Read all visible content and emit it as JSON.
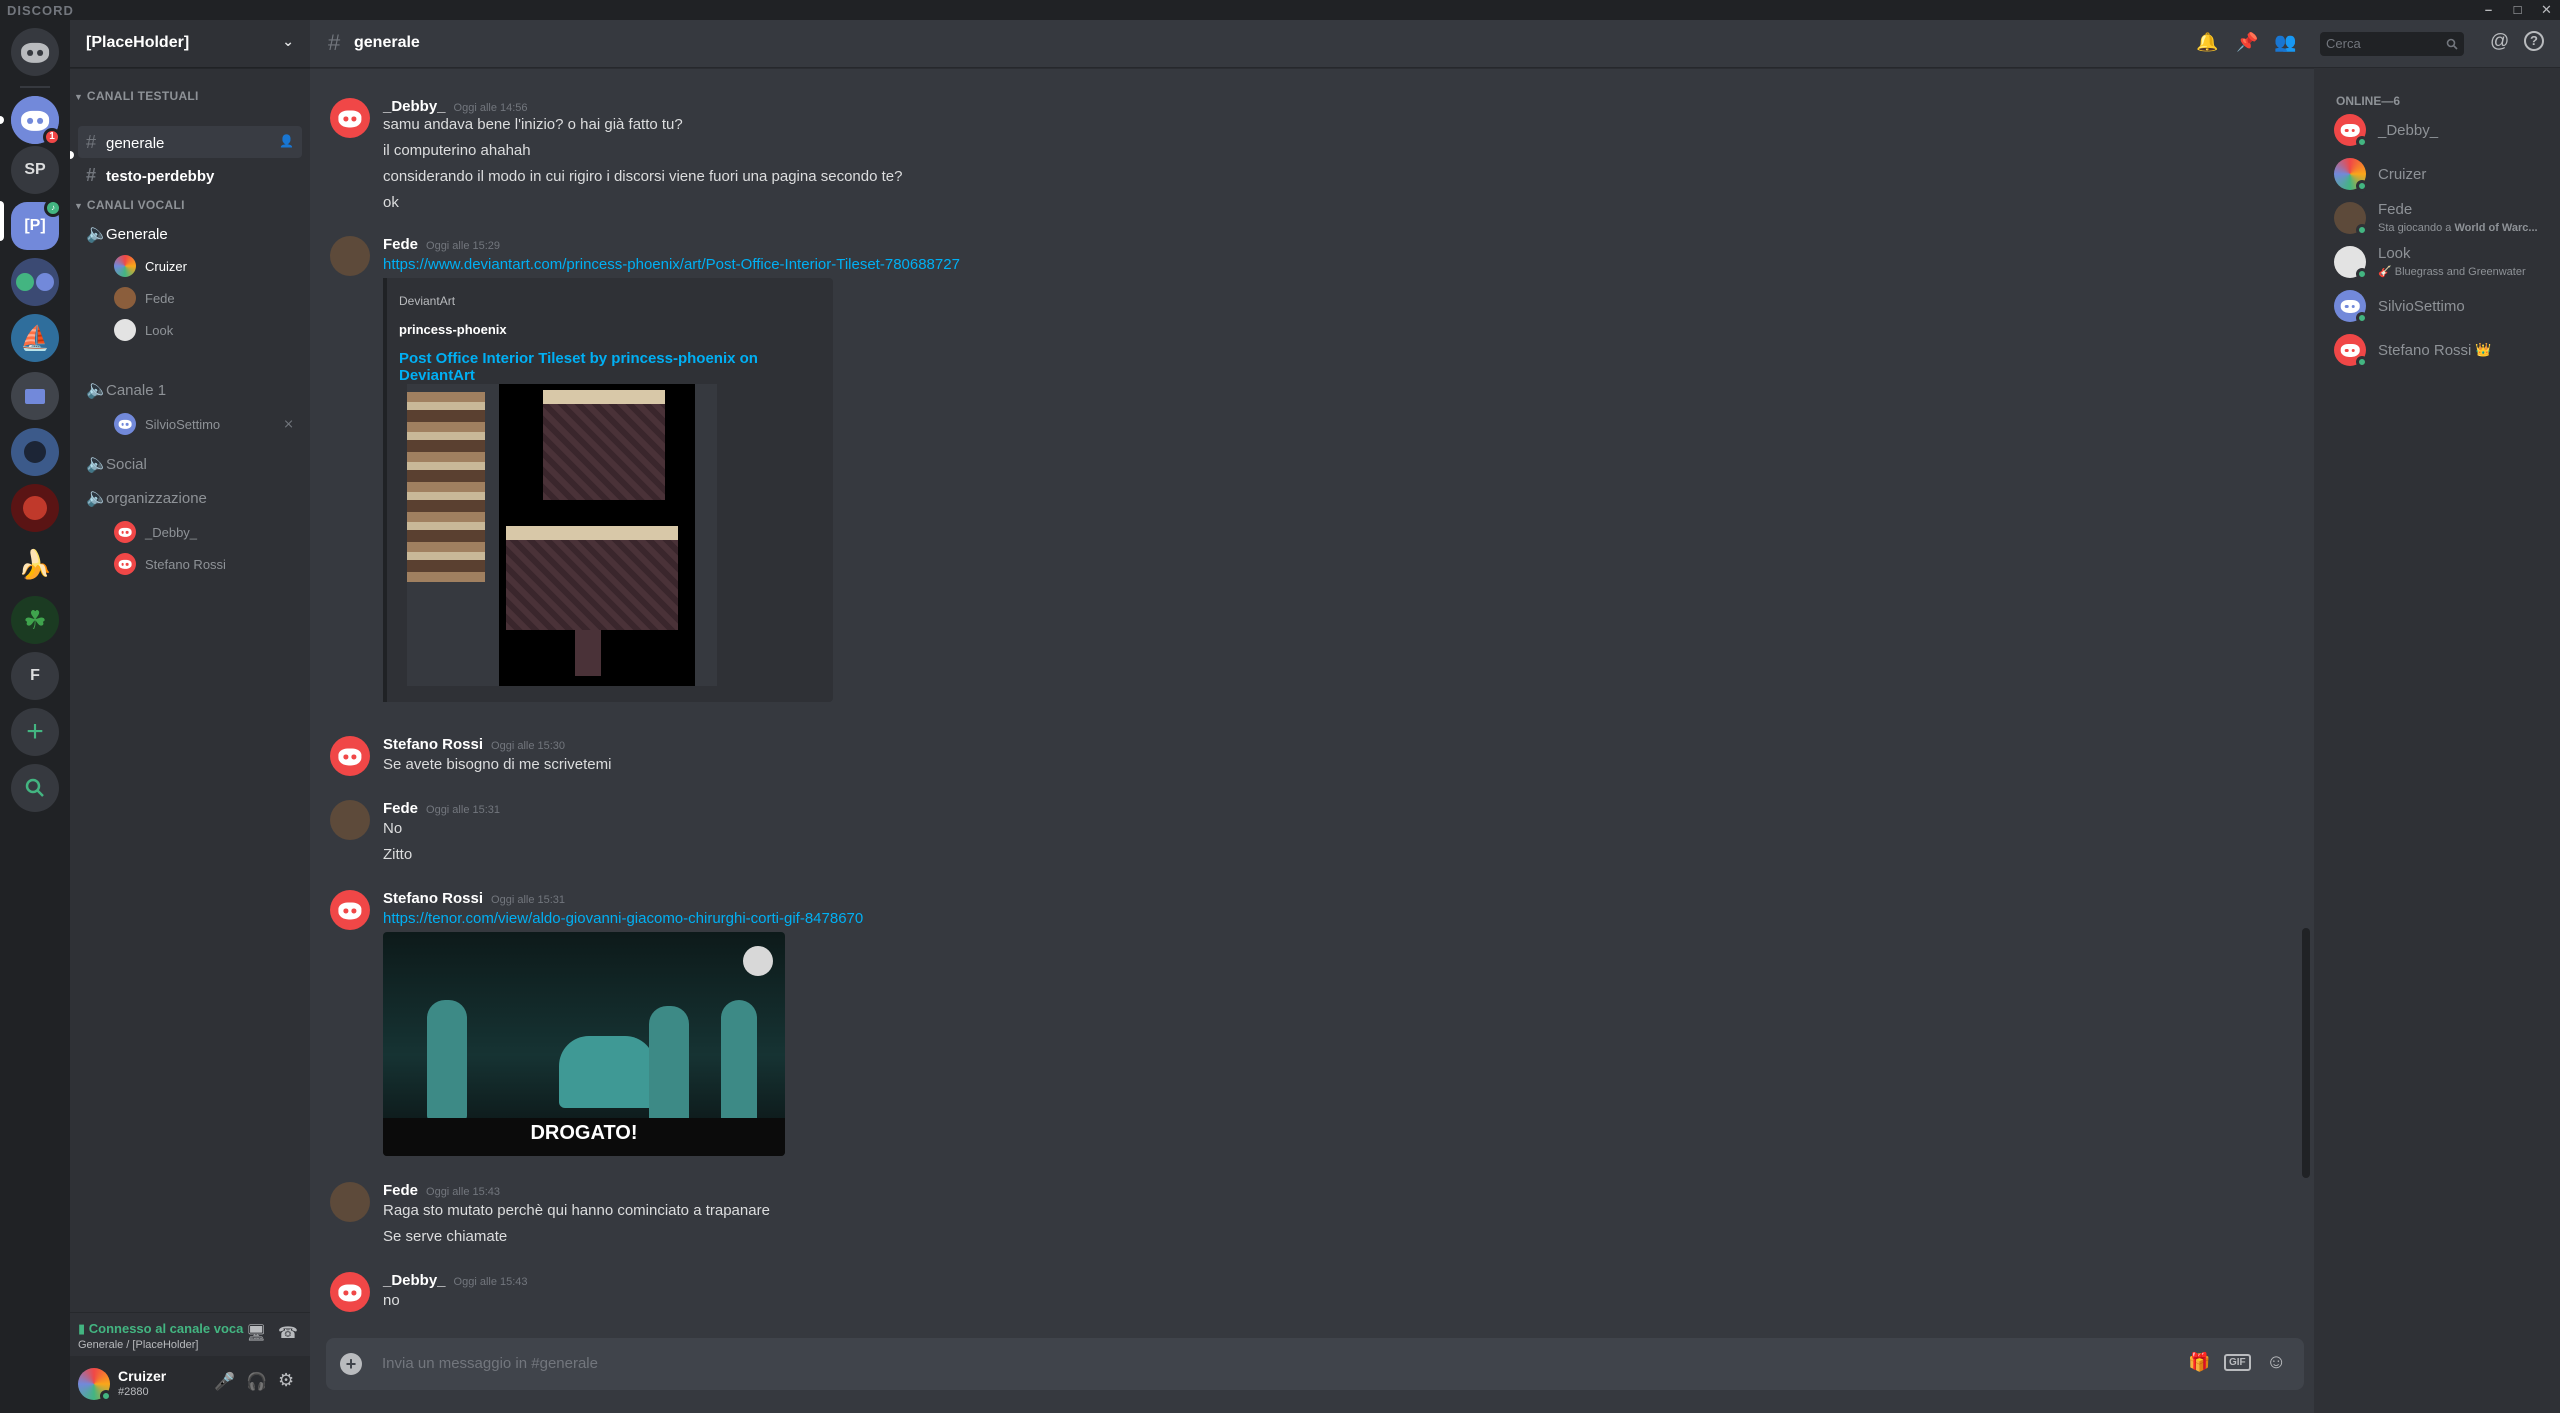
{
  "app": {
    "title": "DISCORD"
  },
  "guild": {
    "name": "[PlaceHolder]",
    "servers": [
      "SP",
      "[P]",
      "F"
    ],
    "home_badge": "1"
  },
  "channels": {
    "text_category": "CANALI TESTUALI",
    "text": [
      {
        "name": "generale",
        "active": true
      },
      {
        "name": "testo-perdebby",
        "unread": true
      }
    ],
    "voice_category": "CANALI VOCALI",
    "voice": [
      {
        "name": "Generale",
        "users": [
          "Cruizer",
          "Fede",
          "Look"
        ]
      },
      {
        "name": "Canale 1",
        "users": [
          "SilvioSettimo"
        ]
      },
      {
        "name": "Social",
        "users": []
      },
      {
        "name": "organizzazione",
        "users": [
          "_Debby_",
          "Stefano Rossi"
        ]
      }
    ]
  },
  "voice_status": {
    "connected": "Connesso al canale voca",
    "location": "Generale / [PlaceHolder]"
  },
  "user": {
    "name": "Cruizer",
    "tag": "#2880"
  },
  "header": {
    "channel": "generale",
    "search_placeholder": "Cerca"
  },
  "messages": [
    {
      "author": "_Debby_",
      "time": "Oggi alle 14:56",
      "lines": [
        "samu andava bene l'inizio? o hai già fatto tu?",
        "il computerino ahahah",
        "considerando il modo in cui rigiro i discorsi viene fuori una pagina secondo te?",
        "ok"
      ]
    },
    {
      "author": "Fede",
      "time": "Oggi alle 15:29",
      "link": "https://www.deviantart.com/princess-phoenix/art/Post-Office-Interior-Tileset-780688727",
      "embed": {
        "provider": "DeviantArt",
        "author": "princess-phoenix",
        "title": "Post Office Interior Tileset by princess-phoenix on DeviantArt"
      }
    },
    {
      "author": "Stefano Rossi",
      "time": "Oggi alle 15:30",
      "lines": [
        "Se avete bisogno di me scrivetemi"
      ]
    },
    {
      "author": "Fede",
      "time": "Oggi alle 15:31",
      "lines": [
        "No",
        "Zitto"
      ]
    },
    {
      "author": "Stefano Rossi",
      "time": "Oggi alle 15:31",
      "link": "https://tenor.com/view/aldo-giovanni-giacomo-chirurghi-corti-gif-8478670",
      "gif_caption": "DROGATO!"
    },
    {
      "author": "Fede",
      "time": "Oggi alle 15:43",
      "lines": [
        "Raga sto mutato perchè qui hanno cominciato a trapanare",
        "Se serve chiamate"
      ]
    },
    {
      "author": "_Debby_",
      "time": "Oggi alle 15:43",
      "lines": [
        "no"
      ]
    }
  ],
  "composer": {
    "placeholder": "Invia un messaggio in #generale",
    "gif_label": "GIF"
  },
  "members": {
    "header": "ONLINE—6",
    "list": [
      {
        "name": "_Debby_"
      },
      {
        "name": "Cruizer"
      },
      {
        "name": "Fede",
        "activity_prefix": "Sta giocando a ",
        "activity": "World of Warc..."
      },
      {
        "name": "Look",
        "activity": "Bluegrass and Greenwater"
      },
      {
        "name": "SilvioSettimo"
      },
      {
        "name": "Stefano Rossi",
        "crown": "👑"
      }
    ]
  },
  "colors": {
    "accent": "#7289da",
    "link": "#00b0f4",
    "online": "#43b581",
    "danger": "#f04747",
    "voice_connected": "#43b581"
  }
}
